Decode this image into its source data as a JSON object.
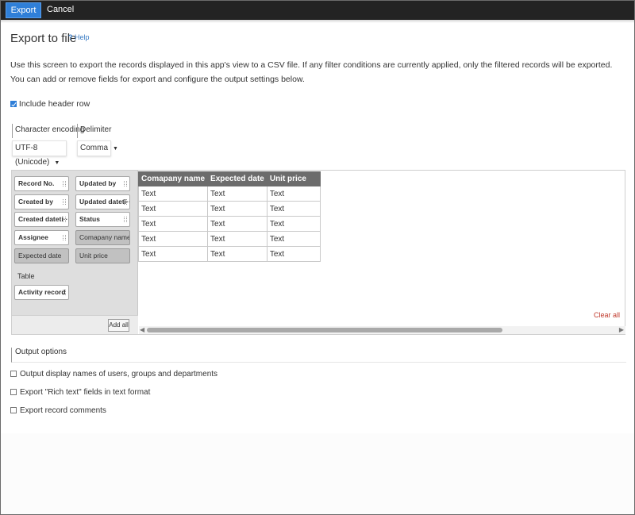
{
  "toolbar": {
    "export_label": "Export",
    "cancel_label": "Cancel"
  },
  "header": {
    "title": "Export to file",
    "help_icon": "?",
    "help_label": "Help"
  },
  "description": {
    "line1": "Use this screen to export the records displayed in this app's view to a CSV file. If any filter conditions are currently applied, only the filtered records will be exported.",
    "line2": "You can add or remove fields for export and configure the output settings below."
  },
  "include_header": {
    "label": "Include header row",
    "checked": true
  },
  "encoding": {
    "label": "Character encoding",
    "value": "UTF-8 (Unicode)"
  },
  "delimiter": {
    "label": "Delimiter",
    "value": "Comma"
  },
  "fields": [
    {
      "label": "Record No."
    },
    {
      "label": "Updated by"
    },
    {
      "label": "Created by"
    },
    {
      "label": "Updated dateti···"
    },
    {
      "label": "Created dateti···"
    },
    {
      "label": "Status"
    },
    {
      "label": "Assignee"
    },
    {
      "label": "Comapany name"
    },
    {
      "label": "Expected date"
    },
    {
      "label": "Unit price"
    }
  ],
  "table_section": {
    "label": "Table",
    "chip": "Activity record"
  },
  "add_all_label": "Add all",
  "clear_all_label": "Clear all",
  "grid": {
    "columns": [
      "Comapany name",
      "Expected date",
      "Unit price"
    ],
    "rows": [
      [
        "Text",
        "Text",
        "Text"
      ],
      [
        "Text",
        "Text",
        "Text"
      ],
      [
        "Text",
        "Text",
        "Text"
      ],
      [
        "Text",
        "Text",
        "Text"
      ],
      [
        "Text",
        "Text",
        "Text"
      ]
    ]
  },
  "output_options": {
    "label": "Output options",
    "items": [
      {
        "label": "Output display names of users, groups and departments",
        "checked": false
      },
      {
        "label": "Export \"Rich text\" fields in text format",
        "checked": false
      },
      {
        "label": "Export record comments",
        "checked": false
      }
    ]
  },
  "icons": {
    "dropdown": "dropdown-arrow-icon",
    "scroll_left": "scroll-left-icon",
    "scroll_right": "scroll-right-icon",
    "grip": "drag-handle-icon"
  },
  "colors": {
    "accent": "#2f7fd8",
    "topbar": "#232323",
    "header_cell": "#6c6c6c",
    "clear_all": "#c0392b"
  }
}
